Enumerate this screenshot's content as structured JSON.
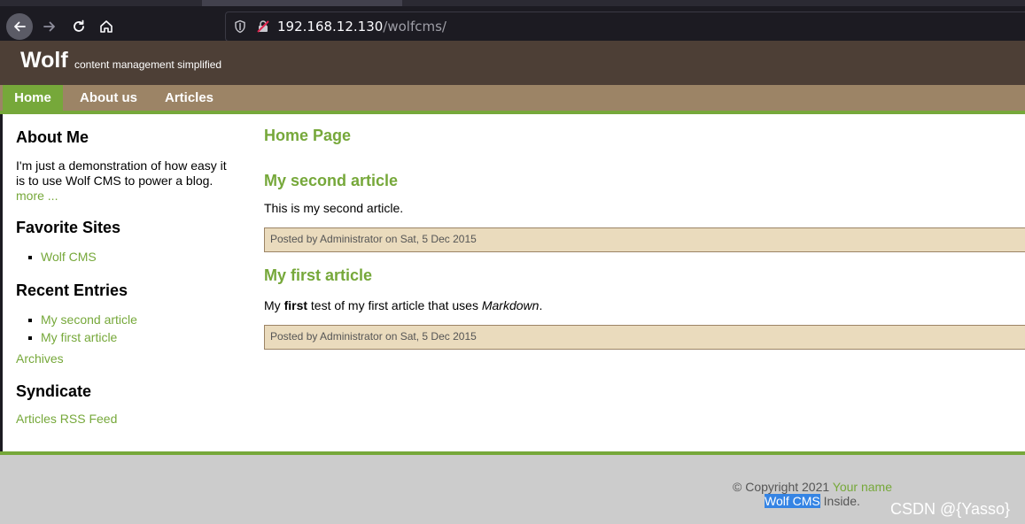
{
  "browser": {
    "url_host": "192.168.12.130",
    "url_path": "/wolfcms/"
  },
  "header": {
    "title": "Wolf",
    "slogan": "content management simplified"
  },
  "nav": {
    "items": [
      {
        "label": "Home",
        "active": true
      },
      {
        "label": "About us",
        "active": false
      },
      {
        "label": "Articles",
        "active": false
      }
    ]
  },
  "sidebar": {
    "about_title": "About Me",
    "about_text": "I'm just a demonstration of how easy it is to use Wolf CMS to power a blog.",
    "about_more": "more ...",
    "favorites_title": "Favorite Sites",
    "favorites": [
      "Wolf CMS"
    ],
    "recent_title": "Recent Entries",
    "recent": [
      "My second article",
      "My first article"
    ],
    "archives_link": "Archives",
    "syndicate_title": "Syndicate",
    "rss_link": "Articles RSS Feed"
  },
  "main": {
    "page_title": "Home Page",
    "articles": [
      {
        "title": "My second article",
        "body": "This is my second article.",
        "info": "Posted by Administrator on Sat, 5 Dec 2015"
      },
      {
        "title": "My first article",
        "body_prefix": "My ",
        "body_bold": "first",
        "body_middle": " test of my first article that uses ",
        "body_italic": "Markdown",
        "body_suffix": ".",
        "info": "Posted by Administrator on Sat, 5 Dec 2015"
      }
    ]
  },
  "footer": {
    "copyright": "© Copyright 2021 ",
    "your_name": "Your name",
    "wolf_cms": "Wolf CMS",
    "inside": " Inside.",
    "watermark": "CSDN @{Yasso}"
  },
  "colors": {
    "accent": "#76a83a",
    "header_bg": "#4d3f36",
    "nav_bg": "#9c8466",
    "info_bg": "#eadbbd",
    "footer_bg": "#cccccc"
  }
}
